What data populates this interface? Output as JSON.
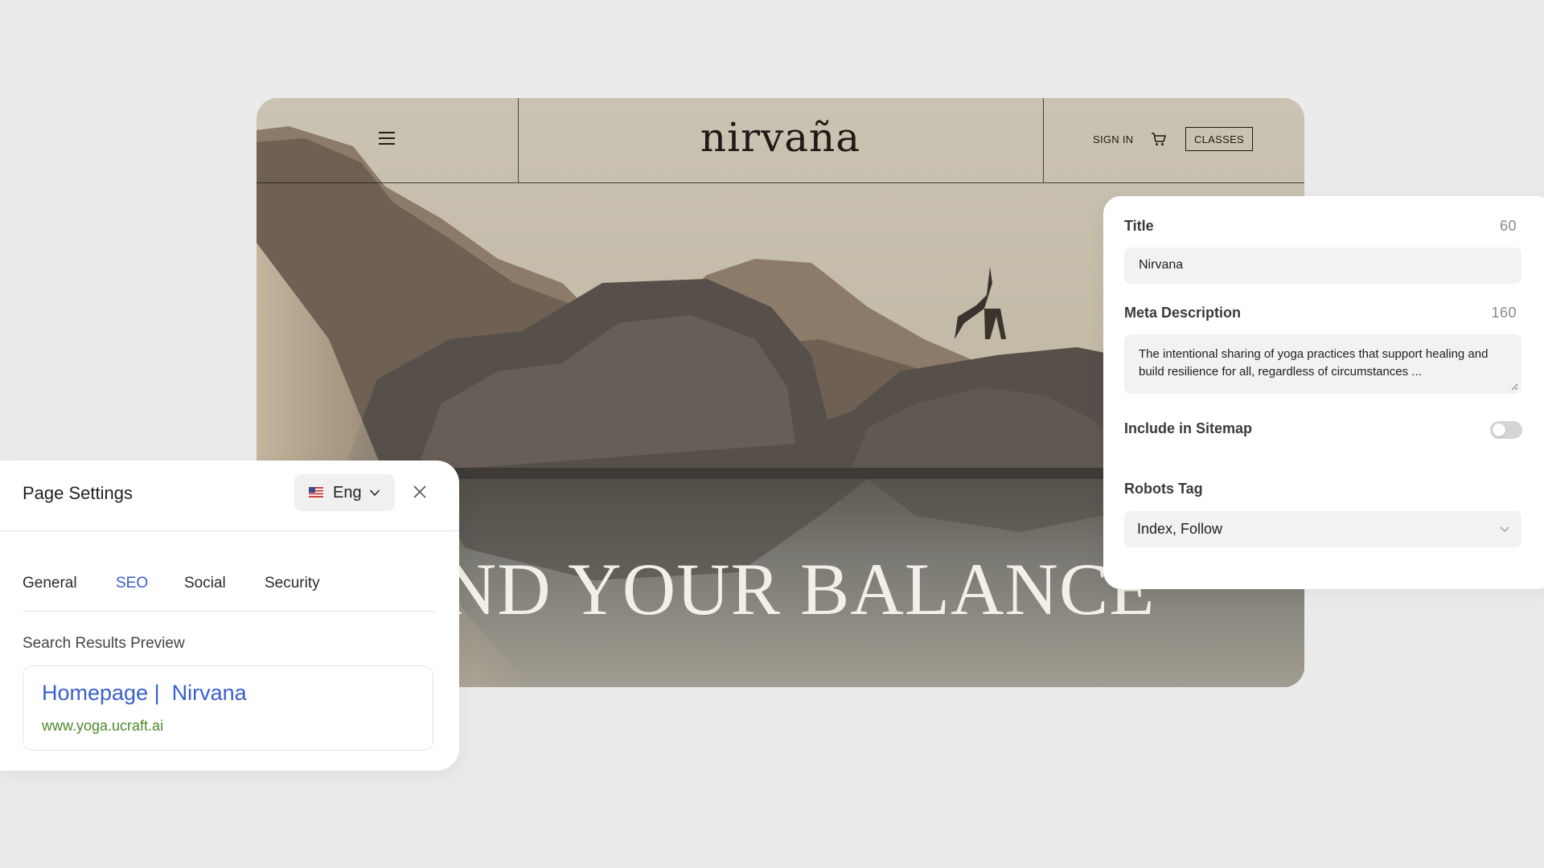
{
  "colors": {
    "page_background": "#ebebeb",
    "accent_blue": "#3a5fcb",
    "url_green": "#4a8a2c",
    "field_background": "#f2f2f2"
  },
  "site_preview": {
    "logo": "nirvaña",
    "menu_icon": "hamburger-menu-icon",
    "sign_in_label": "SIGN IN",
    "cart_icon": "shopping-cart-icon",
    "classes_label": "CLASSES",
    "hero_text": "FIND YOUR BALANCE"
  },
  "seo_panel": {
    "title_label": "Title",
    "title_count": "60",
    "title_value": "Nirvana",
    "meta_label": "Meta Description",
    "meta_count": "160",
    "meta_value": "The intentional sharing of yoga practices that support healing and build resilience for all, regardless of circumstances ...",
    "sitemap_label": "Include in Sitemap",
    "sitemap_enabled": false,
    "robots_label": "Robots Tag",
    "robots_value": "Index, Follow"
  },
  "page_settings": {
    "title": "Page Settings",
    "language_label": "Eng",
    "language_flag": "us-flag-icon",
    "tabs": [
      {
        "label": "General",
        "active": false
      },
      {
        "label": "SEO",
        "active": true
      },
      {
        "label": "Social",
        "active": false
      },
      {
        "label": "Security",
        "active": false
      }
    ],
    "preview_label": "Search Results Preview",
    "preview_title": "Homepage |  Nirvana",
    "preview_url": "www.yoga.ucraft.ai"
  }
}
